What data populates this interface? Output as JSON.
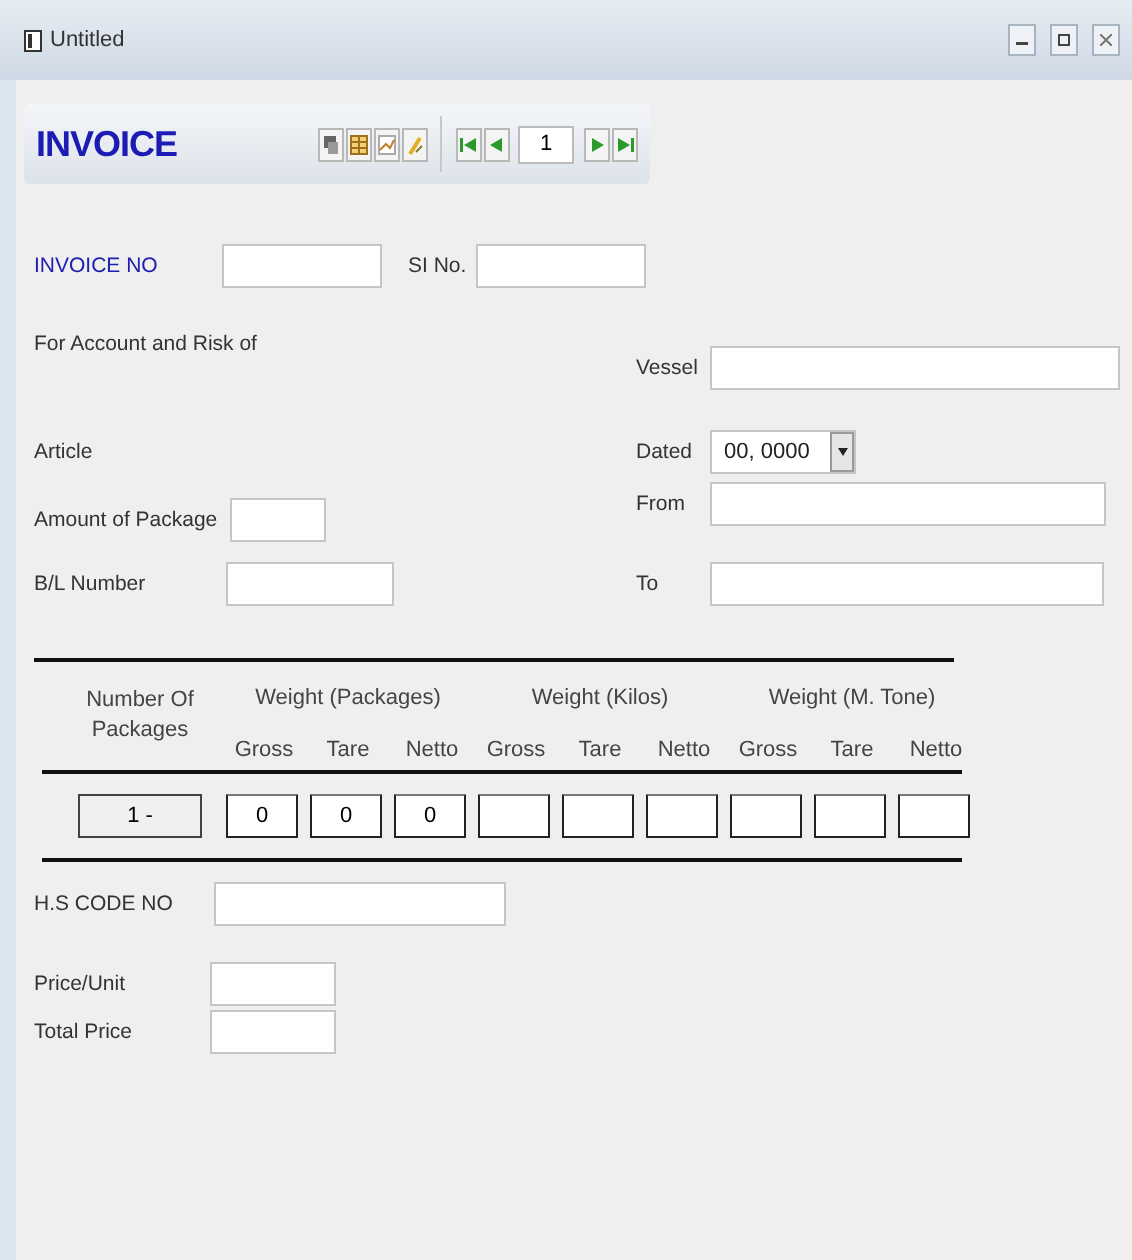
{
  "window": {
    "title": "Untitled"
  },
  "toolbar": {
    "title": "INVOICE",
    "record": "1"
  },
  "form": {
    "invoice_no": "INVOICE NO",
    "si_no": "SI No.",
    "account": "For Account and Risk of",
    "vessel": "Vessel",
    "article": "Article",
    "dated": {
      "label": "Dated",
      "value": "00, 0000"
    },
    "amount": "Amount of Package",
    "from": "From",
    "bl_number": "B/L Number",
    "to": "To"
  },
  "table": {
    "number_header": "Number Of Packages",
    "groups": [
      {
        "label": "Weight (Packages)",
        "columns": [
          {
            "header": "Gross",
            "value": "0"
          },
          {
            "header": "Tare",
            "value": "0"
          },
          {
            "header": "Netto",
            "value": "0"
          }
        ]
      },
      {
        "label": "Weight (Kilos)",
        "columns": [
          {
            "header": "Gross"
          },
          {
            "header": "Tare"
          },
          {
            "header": "Netto"
          }
        ]
      },
      {
        "label": "Weight (M. Tone)",
        "columns": [
          {
            "header": "Gross"
          },
          {
            "header": "Tare"
          },
          {
            "header": "Netto"
          }
        ]
      }
    ],
    "row_number": "1 -"
  },
  "footer": {
    "hs_code": "H.S CODE NO",
    "price_unit": "Price/Unit",
    "total_price": "Total Price"
  }
}
